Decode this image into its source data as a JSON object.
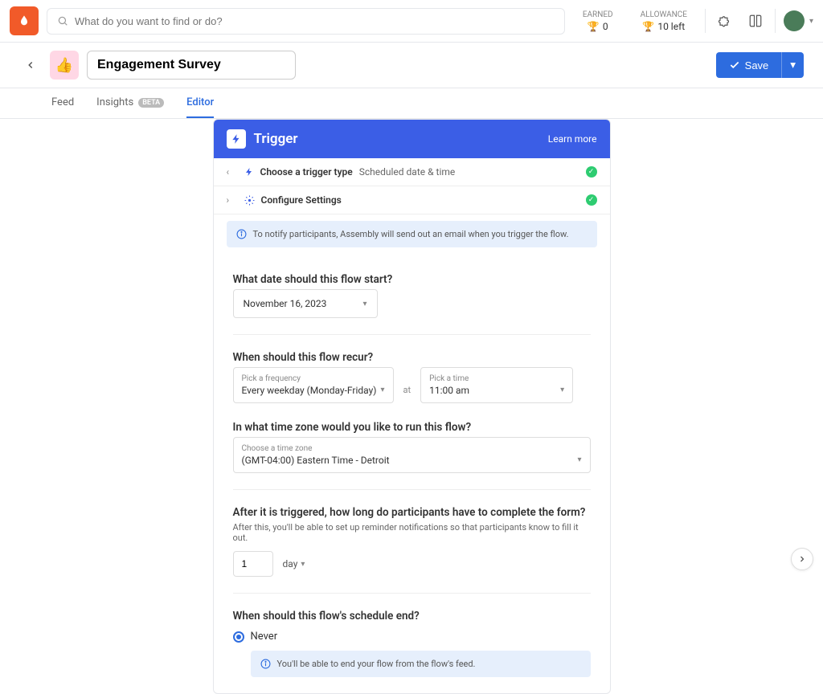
{
  "topbar": {
    "search_placeholder": "What do you want to find or do?",
    "earned_label": "EARNED",
    "earned_value": "0",
    "allowance_label": "ALLOWANCE",
    "allowance_value": "10 left"
  },
  "header": {
    "emoji": "👍",
    "title": "Engagement Survey",
    "save_label": "Save"
  },
  "tabs": {
    "feed": "Feed",
    "insights": "Insights",
    "insights_badge": "BETA",
    "editor": "Editor"
  },
  "card": {
    "title": "Trigger",
    "learn_more": "Learn more",
    "step1_label": "Choose a trigger type",
    "step1_value": "Scheduled date & time",
    "step2_label": "Configure Settings",
    "notify_info": "To notify participants, Assembly will send out an email when you trigger the flow."
  },
  "form": {
    "start_q": "What date should this flow start?",
    "start_value": "November 16, 2023",
    "recur_q": "When should this flow recur?",
    "freq_label": "Pick a frequency",
    "freq_value": "Every weekday (Monday-Friday)",
    "at": "at",
    "time_label": "Pick a time",
    "time_value": "11:00 am",
    "tz_q": "In what time zone would you like to run this flow?",
    "tz_label": "Choose a time zone",
    "tz_value": "(GMT-04:00) Eastern Time - Detroit",
    "complete_q": "After it is triggered, how long do participants have to complete the form?",
    "complete_help": "After this, you'll be able to set up reminder notifications so that participants know to fill it out.",
    "complete_num": "1",
    "complete_unit": "day",
    "end_q": "When should this flow's schedule end?",
    "end_never": "Never",
    "end_info": "You'll be able to end your flow from the flow's feed."
  }
}
